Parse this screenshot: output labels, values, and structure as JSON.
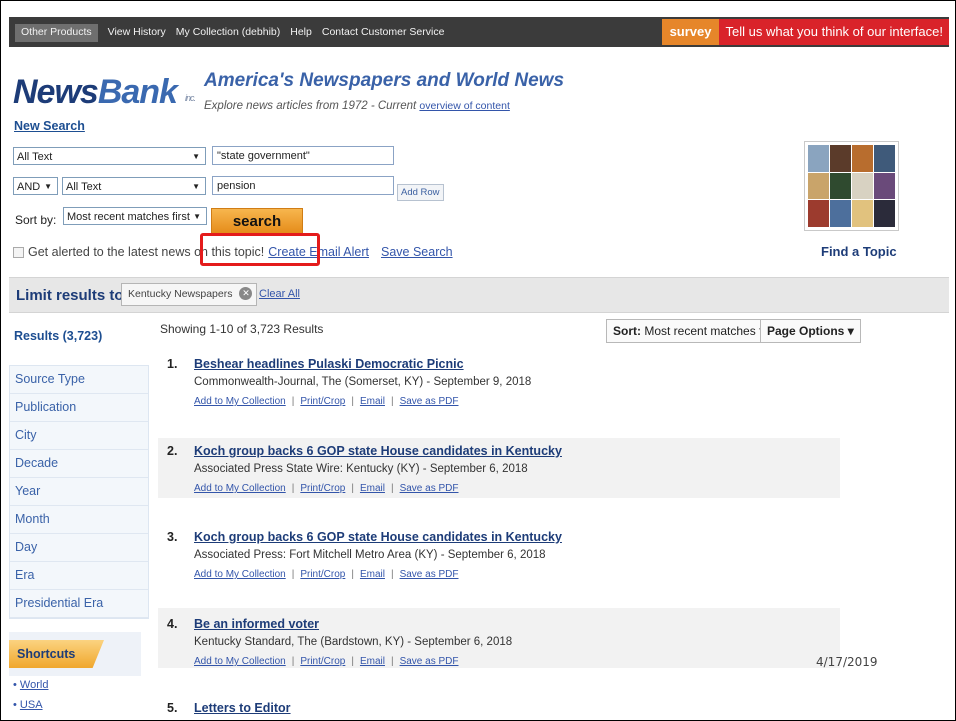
{
  "topnav": {
    "links": [
      "Other Products",
      "View History",
      "My Collection (debhib)",
      "Help",
      "Contact Customer Service"
    ],
    "survey_tag": "survey",
    "survey_msg": "Tell us what you think of our interface!"
  },
  "header": {
    "logo_news": "News",
    "logo_bank": "Bank",
    "logo_inc": "inc.",
    "new_search": "New Search",
    "product_title": "America's Newspapers and World News",
    "product_subtitle": "Explore news articles from 1972 - Current",
    "overview_link": "overview of content"
  },
  "search": {
    "row1_field": "All Text",
    "row1_value": "\"state government\"",
    "row2_operator": "AND",
    "row2_field": "All Text",
    "row2_value": "pension",
    "add_row": "Add Row",
    "sort_label": "Sort by:",
    "sort_value": "Most recent matches first",
    "search_button": "search",
    "alert_text": "Get alerted to the latest news on this topic!",
    "create_alert": "Create Email Alert",
    "save_search": "Save Search"
  },
  "find_topic": {
    "label": "Find a Topic"
  },
  "limit": {
    "label": "Limit results to:",
    "chip": "Kentucky Newspapers",
    "clear_all": "Clear All"
  },
  "sidebar": {
    "results_count": "Results (3,723)",
    "facets": [
      "Source Type",
      "Publication",
      "City",
      "Decade",
      "Year",
      "Month",
      "Day",
      "Era",
      "Presidential Era"
    ],
    "shortcuts_label": "Shortcuts",
    "shortcut_links": [
      "World",
      "USA"
    ]
  },
  "results": {
    "showing": "Showing 1-10 of 3,723 Results",
    "sort_label": "Sort:",
    "sort_value": "Most recent matches first",
    "page_options": "Page Options",
    "actions": [
      "Add to My Collection",
      "Print/Crop",
      "Email",
      "Save as PDF"
    ],
    "items": [
      {
        "num": "1.",
        "title": "Beshear headlines Pulaski Democratic Picnic",
        "source": "Commonwealth-Journal, The (Somerset, KY) - September 9, 2018"
      },
      {
        "num": "2.",
        "title": "Koch group backs 6 GOP state House candidates in Kentucky",
        "source": "Associated Press State Wire: Kentucky (KY) - September 6, 2018"
      },
      {
        "num": "3.",
        "title": "Koch group backs 6 GOP state House candidates in Kentucky",
        "source": "Associated Press: Fort Mitchell Metro Area (KY) - September 6, 2018"
      },
      {
        "num": "4.",
        "title": "Be an informed voter",
        "source": "Kentucky Standard, The (Bardstown, KY) - September 6, 2018"
      },
      {
        "num": "5.",
        "title": "Letters to Editor",
        "source": ""
      }
    ]
  },
  "slide_date": "4/17/2019",
  "colors": {
    "accent_orange": "#e6862a",
    "survey_red": "#d9232a",
    "highlight_red": "#e41b1b",
    "brand_blue": "#1d3c78"
  }
}
